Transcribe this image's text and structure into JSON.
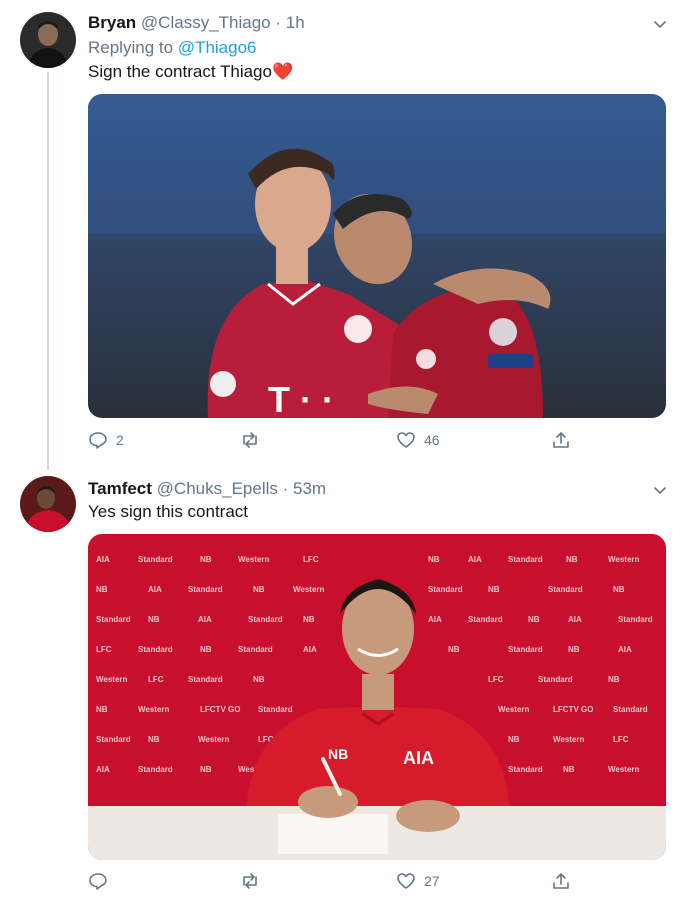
{
  "tweets": [
    {
      "author": {
        "name": "Bryan",
        "handle": "@Classy_Thiago",
        "dot": "·",
        "time": "1h"
      },
      "replying_prefix": "Replying to",
      "replying_to": "@Thiago6",
      "text": "Sign the contract Thiago",
      "emoji": "❤️",
      "media_icon": "photo-two-players-embracing",
      "stats": {
        "replies": "2",
        "retweets": "",
        "likes": "46"
      }
    },
    {
      "author": {
        "name": "Tamfect",
        "handle": "@Chuks_Epells",
        "dot": "·",
        "time": "53m"
      },
      "text": "Yes sign this contract",
      "media_icon": "photo-player-signing-contract",
      "stats": {
        "replies": "",
        "retweets": "",
        "likes": "27"
      }
    }
  ],
  "colors": {
    "link": "#1da1f2",
    "muted": "#657786",
    "heart": "#e0245e",
    "liverpool_red": "#c8102e",
    "bayern_red": "#b81d3a"
  }
}
